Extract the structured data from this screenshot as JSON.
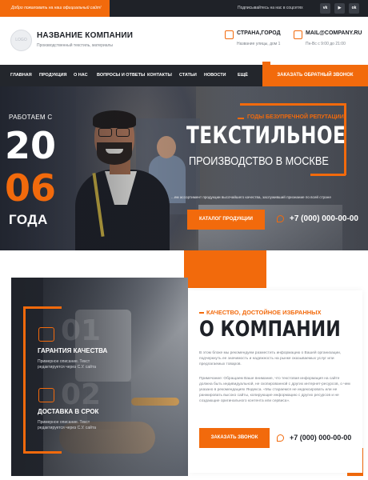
{
  "topbar": {
    "welcome": "Добро пожаловать на наш официальный сайт!",
    "social_text": "Подписывайтесь на нас в соцсетях",
    "social": [
      {
        "name": "vk-icon",
        "glyph": "vk"
      },
      {
        "name": "youtube-icon",
        "glyph": "▶"
      },
      {
        "name": "odnoklassniki-icon",
        "glyph": "ok"
      }
    ]
  },
  "header": {
    "logo_text": "LOGO",
    "company": "НАЗВАНИЕ КОМПАНИИ",
    "tagline": "Производственный текстиль, материалы",
    "city": "СТРАНА,ГОРОД",
    "address": "Название улицы, дом 1",
    "email": "MAIL@COMPANY.RU",
    "hours": "Пн-Вс с 9:00 до 21:00"
  },
  "nav": {
    "items": [
      "ГЛАВНАЯ",
      "ПРОДУКЦИЯ",
      "О НАС",
      "ВОПРОСЫ И ОТВЕТЫ",
      "КОНТАКТЫ",
      "СТАТЬИ",
      "НОВОСТИ",
      "ЕЩЁ"
    ],
    "cta": "ЗАКАЗАТЬ ОБРАТНЫЙ ЗВОНОК"
  },
  "hero": {
    "since_label": "РАБОТАЕМ С",
    "year_part1": "20",
    "year_part2": "06",
    "years_label": "ГОДА",
    "eyebrow": "ГОДЫ БЕЗУПРЕЧНОЙ РЕПУТАЦИИ",
    "title": "ТЕКСТИЛЬНОЕ",
    "subtitle": "ПРОИЗВОДСТВО В МОСКВЕ",
    "description": "...ем ассортимент продукции высочайшего качества, заслуживший признание по всей стране",
    "button": "КАТАЛОГ ПРОДУКЦИИ",
    "phone": "+7 (000) 000-00-00"
  },
  "features": [
    {
      "number": "01",
      "title": "ГАРАНТИЯ КАЧЕСТВА",
      "text": "Примерное описание. Текст редактируется через С.У. сайта"
    },
    {
      "number": "02",
      "title": "ДОСТАВКА В СРОК",
      "text": "Примерное описание. Текст редактируется через С.У. сайта"
    }
  ],
  "about": {
    "eyebrow": "КАЧЕСТВО, ДОСТОЙНОЕ ИЗБРАННЫХ",
    "title": "О КОМПАНИИ",
    "paragraph1": "В этом блоке мы рекомендуем разместить информацию о Вашей организации, подчеркнуть ее значимость и надежность на рынке оказываемых услуг или предлагаемых товаров.",
    "paragraph2": "Примечание: Обращаем Ваше внимание, что текстовая информация на сайте должна быть индивидуальной, не скопированной с других интернет-ресурсов, о чем указано в рекомендациях Яндекса. «Мы стараемся не индексировать или не ранжировать высоко сайты, копирующие информацию с других ресурсов и не создающие оригинального контента или сервиса».",
    "button": "ЗАКАЗАТЬ ЗВОНОК",
    "phone": "+7 (000) 000-00-00"
  },
  "colors": {
    "accent": "#f26a0c",
    "dark": "#23262c",
    "text": "#1e2127"
  }
}
